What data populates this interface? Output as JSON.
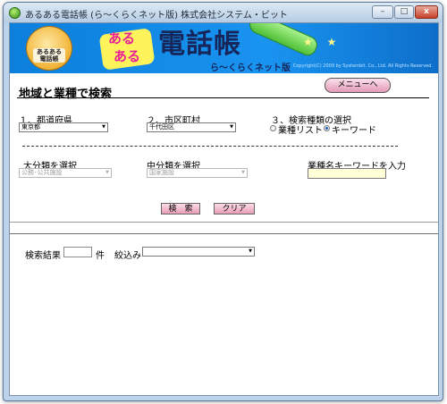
{
  "window": {
    "title": "あるある電話帳 (ら～くらくネット版)   株式会社システム・ビット",
    "minimize_glyph": "–",
    "maximize_glyph": "□",
    "close_glyph": "x"
  },
  "banner": {
    "mascot_label": "あるある\n電話帳",
    "logo_aru_1": "ある",
    "logo_aru_2": "ある",
    "logo_main": "電話帳",
    "logo_sub": "ら～くらくネット版",
    "stars": "★ ★",
    "copyright": "Copyright(C) 2009 by Systembit. Co., Ltd. All Rights Reserved."
  },
  "page": {
    "title": "地域と業種で検索",
    "menu_button": "メニューへ"
  },
  "form": {
    "prefecture_label": "１、都道府県",
    "prefecture_value": "東京都",
    "city_label": "２、市区町村",
    "city_value": "千代田区",
    "search_type_label": "３、検索種類の選択",
    "radio_list_label": "業種リスト",
    "radio_keyword_label": "キーワード",
    "major_category_label": "大分類を選択",
    "major_category_value": "公務･公共施設",
    "middle_category_label": "中分類を選択",
    "middle_category_value": "国家施設",
    "keyword_label": "業種名キーワードを入力",
    "keyword_value": "",
    "search_button": "検　索",
    "clear_button": "クリア"
  },
  "results": {
    "label": "検索結果",
    "count": "",
    "unit": "件",
    "filter_label": "絞込み",
    "filter_value": ""
  }
}
